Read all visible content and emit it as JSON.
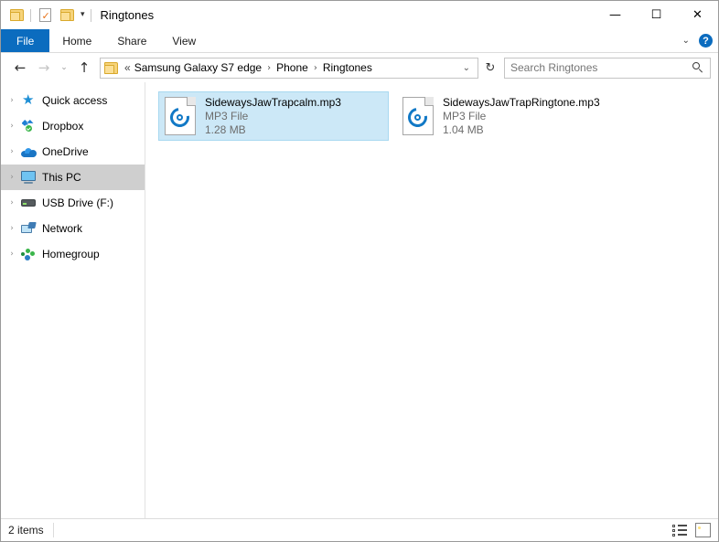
{
  "window": {
    "title": "Ringtones",
    "quick_access": [
      {
        "name": "folder-icon",
        "label": "Folder"
      },
      {
        "name": "properties-icon",
        "label": "Properties"
      },
      {
        "name": "new-folder-icon",
        "label": "New folder"
      }
    ],
    "qat_dropdown": "▾",
    "controls": {
      "minimize": "—",
      "maximize": "☐",
      "close": "✕"
    }
  },
  "ribbon": {
    "tabs": [
      {
        "label": "File",
        "active": true
      },
      {
        "label": "Home",
        "active": false
      },
      {
        "label": "Share",
        "active": false
      },
      {
        "label": "View",
        "active": false
      }
    ],
    "expand_chevron": "⌄",
    "help_label": "?"
  },
  "address": {
    "back": "←",
    "forward": "→",
    "recent": "⌄",
    "up": "↑",
    "breadcrumb_overflow": "«",
    "crumbs": [
      "Samsung Galaxy S7 edge",
      "Phone",
      "Ringtones"
    ],
    "separator": "›",
    "dropdown_chevron": "⌄",
    "refresh": "↻"
  },
  "search": {
    "placeholder": "Search Ringtones"
  },
  "sidebar": {
    "items": [
      {
        "label": "Quick access",
        "icon": "star-icon",
        "selected": false
      },
      {
        "label": "Dropbox",
        "icon": "dropbox-icon",
        "selected": false
      },
      {
        "label": "OneDrive",
        "icon": "cloud-icon",
        "selected": false
      },
      {
        "label": "This PC",
        "icon": "monitor-icon",
        "selected": true
      },
      {
        "label": "USB Drive (F:)",
        "icon": "usb-drive-icon",
        "selected": false
      },
      {
        "label": "Network",
        "icon": "network-icon",
        "selected": false
      },
      {
        "label": "Homegroup",
        "icon": "homegroup-icon",
        "selected": false
      }
    ],
    "expand_chevron": "›"
  },
  "files": [
    {
      "name": "SidewaysJawTrapcalm.mp3",
      "type": "MP3 File",
      "size": "1.28 MB",
      "icon": "mp3-file-icon",
      "selected": true
    },
    {
      "name": "SidewaysJawTrapRingtone.mp3",
      "type": "MP3 File",
      "size": "1.04 MB",
      "icon": "mp3-file-icon",
      "selected": false
    }
  ],
  "status": {
    "item_count": "2 items",
    "view_details_label": "Details view",
    "view_large_icons_label": "Large icons view"
  },
  "colors": {
    "accent": "#0b6cbf",
    "selection_fill": "#cce8f7",
    "selection_border": "#a8d8f0",
    "nav_selected": "#cfcfcf",
    "mp3_blue": "#1279c6",
    "folder_yellow": "#f6d37a"
  }
}
